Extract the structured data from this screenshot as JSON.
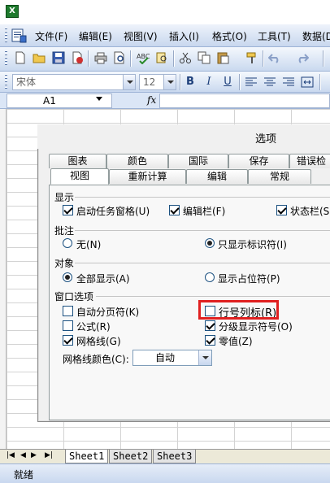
{
  "app": {
    "icon": "excel-app-icon",
    "icon_letter": "X"
  },
  "menu": {
    "items": [
      {
        "label": "文件(F)"
      },
      {
        "label": "编辑(E)"
      },
      {
        "label": "视图(V)"
      },
      {
        "label": "插入(I)"
      },
      {
        "label": "格式(O)"
      },
      {
        "label": "工具(T)"
      },
      {
        "label": "数据(D"
      }
    ]
  },
  "format_toolbar": {
    "font_name": "宋体",
    "font_size": "12",
    "bold": "B",
    "italic": "I",
    "underline": "U"
  },
  "formula_bar": {
    "cell_ref": "A1",
    "fx_label": "fx",
    "value": ""
  },
  "dialog": {
    "title": "选项",
    "tabs_row1": [
      "图表",
      "颜色",
      "国际",
      "保存",
      "错误检"
    ],
    "tabs_row2": [
      "视图",
      "重新计算",
      "编辑",
      "常规"
    ],
    "active_tab": "视图",
    "sections": {
      "display": {
        "label": "显示",
        "options": [
          {
            "label": "启动任务窗格(U)",
            "checked": true
          },
          {
            "label": "编辑栏(F)",
            "checked": true
          },
          {
            "label": "状态栏(S",
            "checked": true
          }
        ]
      },
      "comments": {
        "label": "批注",
        "options": [
          {
            "label": "无(N)",
            "selected": false
          },
          {
            "label": "只显示标识符(I)",
            "selected": true
          }
        ]
      },
      "objects": {
        "label": "对象",
        "options": [
          {
            "label": "全部显示(A)",
            "selected": true
          },
          {
            "label": "显示占位符(P)",
            "selected": false
          }
        ]
      },
      "window": {
        "label": "窗口选项",
        "options": [
          {
            "label": "自动分页符(K)",
            "checked": false
          },
          {
            "label": "行号列标(R)",
            "checked": false
          },
          {
            "label": "公式(R)",
            "checked": false
          },
          {
            "label": "分级显示符号(O)",
            "checked": true
          },
          {
            "label": "网格线(G)",
            "checked": true
          },
          {
            "label": "零值(Z)",
            "checked": true
          }
        ],
        "gridline_color_label": "网格线颜色(C):",
        "gridline_color_value": "自动"
      }
    },
    "highlight_color": "#e02020"
  },
  "sheets": [
    {
      "name": "Sheet1",
      "active": true
    },
    {
      "name": "Sheet2",
      "active": false
    },
    {
      "name": "Sheet3",
      "active": false
    }
  ],
  "status": {
    "text": "就绪"
  }
}
